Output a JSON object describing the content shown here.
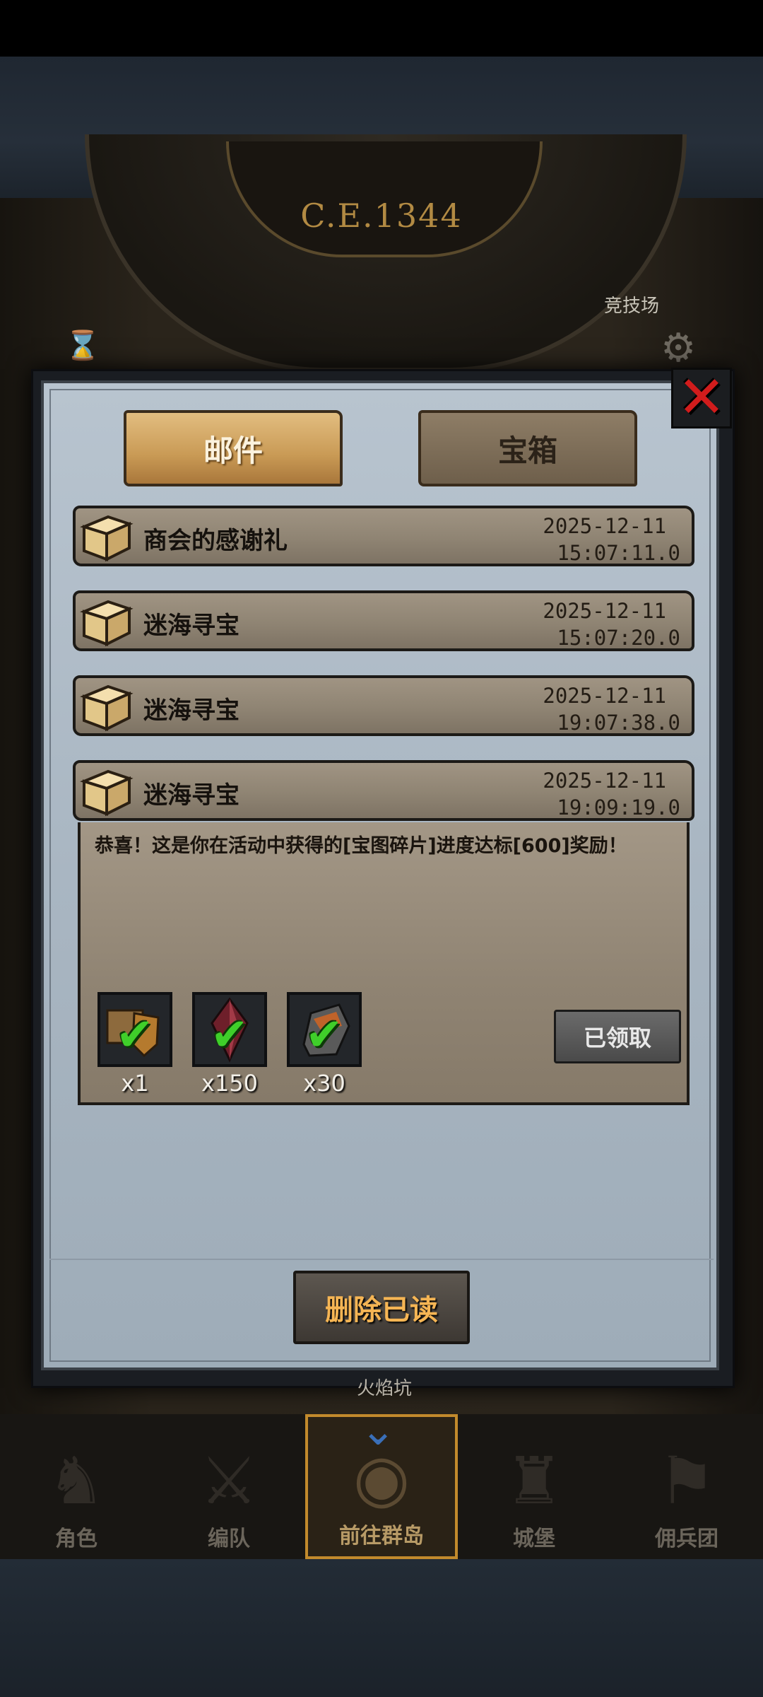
{
  "scene": {
    "era": "C.E.1344",
    "arena_label": "竞技场",
    "behind_label": "火焰坑"
  },
  "tabs": [
    {
      "label": "邮件",
      "active": true
    },
    {
      "label": "宝箱",
      "active": false
    }
  ],
  "mails": [
    {
      "title": "商会的感谢礼",
      "date": "2025-12-11",
      "time": "15:07:11.0"
    },
    {
      "title": "迷海寻宝",
      "date": "2025-12-11",
      "time": "15:07:20.0"
    },
    {
      "title": "迷海寻宝",
      "date": "2025-12-11",
      "time": "19:07:38.0"
    },
    {
      "title": "迷海寻宝",
      "date": "2025-12-11",
      "time": "19:09:19.0"
    }
  ],
  "expanded": {
    "message": "恭喜！这是你在活动中获得的[宝图碎片]进度达标[600]奖励！",
    "rewards": [
      {
        "icon": "chest-shield-icon",
        "qty": "x1"
      },
      {
        "icon": "red-crystal-icon",
        "qty": "x150"
      },
      {
        "icon": "ore-stone-icon",
        "qty": "x30"
      }
    ],
    "claimed_label": "已领取"
  },
  "delete_read_label": "删除已读",
  "nav": [
    {
      "label": "角色",
      "icon": "knight-icon",
      "active": false
    },
    {
      "label": "编队",
      "icon": "formation-icon",
      "active": false
    },
    {
      "label": "前往群岛",
      "icon": "globe-icon",
      "active": true
    },
    {
      "label": "城堡",
      "icon": "castle-icon",
      "active": false
    },
    {
      "label": "佣兵团",
      "icon": "mercenary-icon",
      "active": false
    }
  ],
  "colors": {
    "accent_gold": "#c99a55",
    "close_red": "#d11c1c",
    "check_green": "#3fcf2a",
    "delete_text": "#f5b554"
  }
}
